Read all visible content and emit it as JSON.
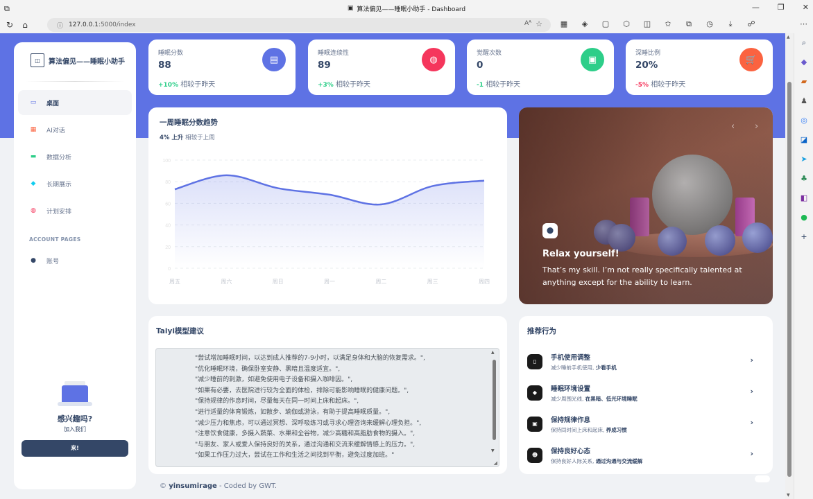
{
  "browser": {
    "tab_title": "算法偏见——睡眠小助手 - Dashboard",
    "url_host": "127.0.0.1",
    "url_path": ":5000/index"
  },
  "sidebar": {
    "brand": "算法偏见——睡眠小助手",
    "items": [
      {
        "label": "桌面",
        "icon": "desktop-icon",
        "color": "#5e72e4"
      },
      {
        "label": "AI对话",
        "icon": "calendar-icon",
        "color": "#fb6340"
      },
      {
        "label": "数据分析",
        "icon": "credit-card-icon",
        "color": "#2dce89"
      },
      {
        "label": "长期展示",
        "icon": "cube-icon",
        "color": "#11cdef"
      },
      {
        "label": "计划安排",
        "icon": "globe-icon",
        "color": "#f5365c"
      }
    ],
    "section_label": "ACCOUNT PAGES",
    "account_items": [
      {
        "label": "账号",
        "icon": "user-icon",
        "color": "#344767"
      }
    ],
    "help": {
      "title": "感兴趣吗?",
      "subtitle": "加入我们",
      "button": "来!"
    }
  },
  "stats": [
    {
      "label": "睡眠分数",
      "value": "88",
      "change": "+10%",
      "change_color": "#2dce89",
      "compare": "相较于昨天",
      "icon": "sleep-icon",
      "icon_bg": "#5e72e4"
    },
    {
      "label": "睡眠连续性",
      "value": "89",
      "change": "+3%",
      "change_color": "#2dce89",
      "compare": "相较于昨天",
      "icon": "globe-icon",
      "icon_bg": "#f5365c"
    },
    {
      "label": "觉醒次数",
      "value": "0",
      "change": "-1",
      "change_color": "#2dce89",
      "compare": "相较于昨天",
      "icon": "document-icon",
      "icon_bg": "#2dce89"
    },
    {
      "label": "深睡比例",
      "value": "20%",
      "change": "-5%",
      "change_color": "#f5365c",
      "compare": "相较于昨天",
      "icon": "cart-icon",
      "icon_bg": "#fb6340"
    }
  ],
  "chart_card": {
    "title": "一周睡眠分数趋势",
    "sub_value": "4% 上升",
    "sub_text": "相较于上周"
  },
  "chart_data": {
    "type": "line",
    "categories": [
      "周五",
      "周六",
      "周日",
      "周一",
      "周二",
      "周三",
      "周四"
    ],
    "series": [
      {
        "values": [
          73,
          86,
          74,
          68,
          59,
          76,
          81
        ]
      }
    ],
    "ylim": [
      0,
      100
    ],
    "y_ticks": [
      0,
      20,
      40,
      60,
      80,
      100
    ],
    "line_color": "#5e72e4",
    "grid": true
  },
  "carousel": {
    "title": "Relax yourself!",
    "description": "That’s my skill. I’m not really specifically talented at anything except for the ability to learn."
  },
  "advice": {
    "title": "Taiyi模型建议",
    "lines": [
      "\"尝试增加睡眠时间，以达到成人推荐的7-9小时，以满足身体和大脑的恢复需求。\",",
      "\"优化睡眠环境，确保卧室安静、黑暗且温度适宜。\",",
      "\"减少睡前的刺激，如避免使用电子设备和摄入咖啡因。\",",
      "\"如果有必要，去医院进行较为全面的体检，排除可能影响睡眠的健康问题。\",",
      "\"保持规律的作息时间，尽量每天在同一时间上床和起床。\",",
      "\"进行适量的体育锻炼，如散步、瑜伽或游泳，有助于提高睡眠质量。\",",
      "\"减少压力和焦虑，可以通过冥想、深呼吸练习或寻求心理咨询来缓解心理负担。\",",
      "\"注意饮食健康，多摄入蔬菜、水果和全谷物，减少高糖和高脂肪食物的摄入。\",",
      "\"与朋友、家人或爱人保持良好的关系，通过沟通和交流来缓解情感上的压力。\",",
      "\"如果工作压力过大，尝试在工作和生活之间找到平衡，避免过度加班。\""
    ]
  },
  "recommendations": {
    "title": "推荐行为",
    "items": [
      {
        "title": "手机使用调整",
        "desc": "减少睡前手机使用,",
        "desc_bold": "少看手机",
        "icon": "phone-icon"
      },
      {
        "title": "睡眠环境设置",
        "desc": "减少周围光线,",
        "desc_bold": "在黑暗、低光环境睡眠",
        "icon": "tag-icon"
      },
      {
        "title": "保持规律作息",
        "desc": "保持同时间上床和起床,",
        "desc_bold": "养成习惯",
        "icon": "calendar-icon"
      },
      {
        "title": "保持良好心态",
        "desc": "保持良好人际关系,",
        "desc_bold": "通过沟通与交流缓解",
        "icon": "smile-icon"
      }
    ]
  },
  "footer": {
    "prefix": "©",
    "author": "yinsumirage",
    "suffix": "- Coded by GWT."
  }
}
